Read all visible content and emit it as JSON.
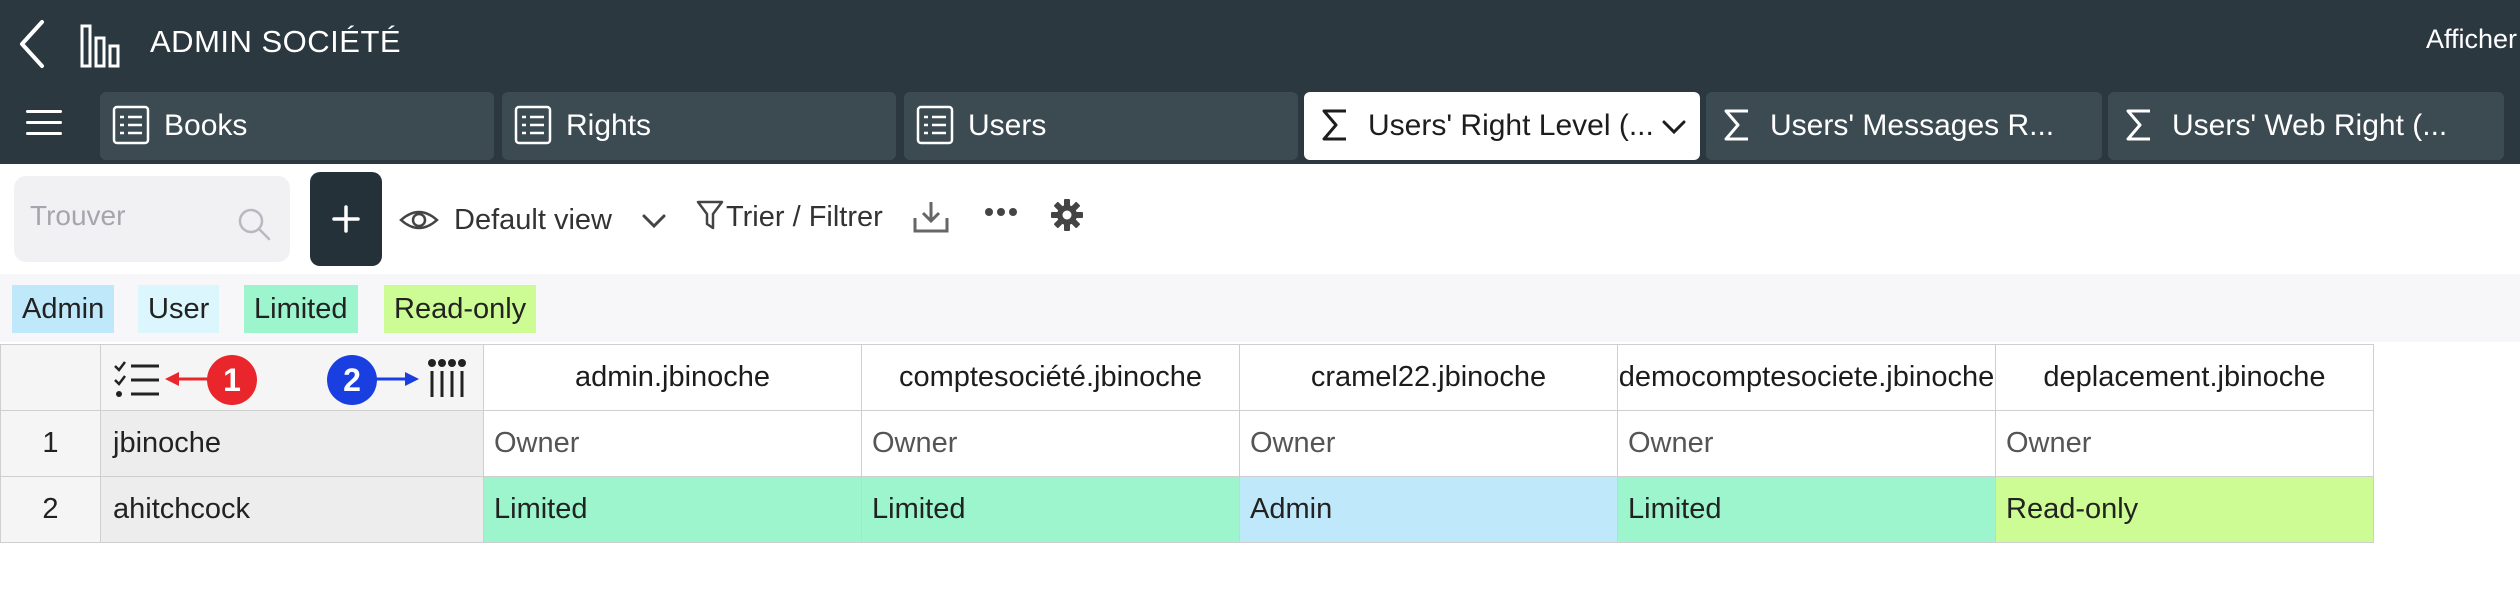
{
  "app": {
    "title": "ADMIN SOCIÉTÉ",
    "display_menu": "Afficher"
  },
  "tabs": [
    {
      "label": "Books",
      "icon": "list-icon",
      "active": false
    },
    {
      "label": "Rights",
      "icon": "list-icon",
      "active": false
    },
    {
      "label": "Users",
      "icon": "list-icon",
      "active": false
    },
    {
      "label": "Users' Right Level (...",
      "icon": "sigma-icon",
      "active": true
    },
    {
      "label": "Users' Messages R...",
      "icon": "sigma-icon",
      "active": false
    },
    {
      "label": "Users' Web Right (...",
      "icon": "sigma-icon",
      "active": false
    }
  ],
  "toolbar": {
    "search_placeholder": "Trouver",
    "view_label": "Default view",
    "sort_label": "Trier / Filtrer"
  },
  "legend": [
    {
      "label": "Admin",
      "color": "#bfe9fb"
    },
    {
      "label": "User",
      "color": "#dbf6fd"
    },
    {
      "label": "Limited",
      "color": "#9cf5cd"
    },
    {
      "label": "Read-only",
      "color": "#ccfc93"
    }
  ],
  "annotations": {
    "marker_1": "1",
    "marker_2": "2"
  },
  "grid": {
    "columns": [
      "admin.jbinoche",
      "comptesociété.jbinoche",
      "cramel22.jbinoche",
      "democomptesociete.jbinoche",
      "deplacement.jbinoche"
    ],
    "rows": [
      {
        "num": "1",
        "name": "jbinoche",
        "cells": [
          "Owner",
          "Owner",
          "Owner",
          "Owner",
          "Owner"
        ]
      },
      {
        "num": "2",
        "name": "ahitchcock",
        "cells": [
          "Limited",
          "Limited",
          "Admin",
          "Limited",
          "Read-only"
        ]
      }
    ]
  },
  "colors": {
    "topbar": "#2b383f",
    "tab_inactive": "#3c4a52",
    "admin": "#bfe9fb",
    "user": "#dbf6fd",
    "limited": "#9cf5cd",
    "read_only": "#ccfc93",
    "marker_1": "#e8262b",
    "marker_2": "#1a3fe0"
  }
}
